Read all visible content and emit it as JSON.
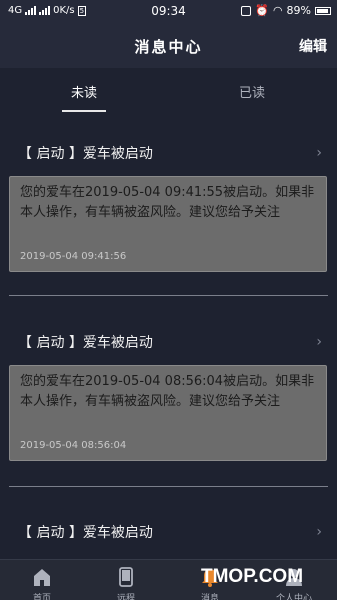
{
  "statusbar": {
    "network": "4G",
    "speed": "0K/s",
    "time": "09:34",
    "battery": "89%"
  },
  "header": {
    "title": "消息中心",
    "edit": "编辑"
  },
  "tabs": [
    {
      "label": "未读",
      "active": true
    },
    {
      "label": "已读",
      "active": false
    }
  ],
  "messages": [
    {
      "title": "【 启动 】爱车被启动",
      "text": "您的爱车在2019-05-04 09:41:55被启动。如果非本人操作，有车辆被盗风险。建议您给予关注",
      "time": "2019-05-04 09:41:56"
    },
    {
      "title": "【 启动 】爱车被启动",
      "text": "您的爱车在2019-05-04 08:56:04被启动。如果非本人操作，有车辆被盗风险。建议您给予关注",
      "time": "2019-05-04 08:56:04"
    },
    {
      "title": "【 启动 】爱车被启动"
    }
  ],
  "bottom_nav": [
    {
      "label": "首页",
      "icon": "home-icon"
    },
    {
      "label": "远程",
      "icon": "phone-icon"
    },
    {
      "label": "消息",
      "icon": "bell-icon"
    },
    {
      "label": "个人中心",
      "icon": "person-icon"
    }
  ],
  "watermark": "TMOP.COM",
  "colors": {
    "background": "#1e2230",
    "bar": "#262a3a",
    "message_box": "#6c6c6c",
    "accent_orange": "#e8872c"
  }
}
